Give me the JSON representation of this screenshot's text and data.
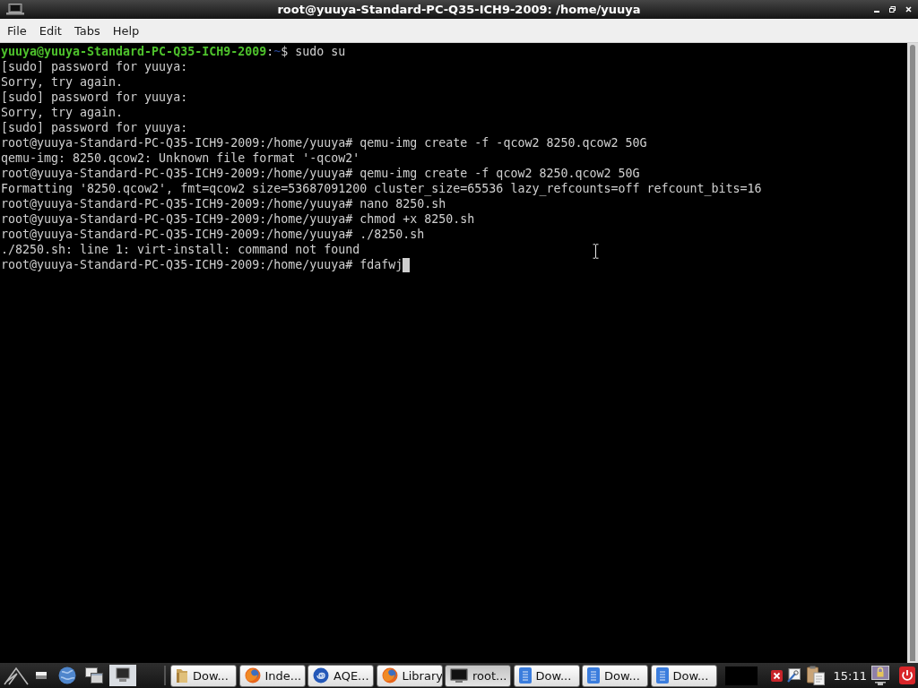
{
  "window": {
    "title": "root@yuuya-Standard-PC-Q35-ICH9-2009: /home/yuuya"
  },
  "menu": [
    "File",
    "Edit",
    "Tabs",
    "Help"
  ],
  "terminal": {
    "lines": [
      {
        "kind": "colored",
        "segments": [
          {
            "kind": "user_host",
            "text": "yuuya@yuuya-Standard-PC-Q35-ICH9-2009"
          },
          {
            "kind": "plain",
            "text": ":"
          },
          {
            "kind": "path",
            "text": "~"
          },
          {
            "kind": "plain",
            "text": "$ sudo su"
          }
        ]
      },
      {
        "kind": "plain",
        "text": "[sudo] password for yuuya:"
      },
      {
        "kind": "plain",
        "text": "Sorry, try again."
      },
      {
        "kind": "plain",
        "text": "[sudo] password for yuuya:"
      },
      {
        "kind": "plain",
        "text": "Sorry, try again."
      },
      {
        "kind": "plain",
        "text": "[sudo] password for yuuya:"
      },
      {
        "kind": "plain",
        "text": "root@yuuya-Standard-PC-Q35-ICH9-2009:/home/yuuya# qemu-img create -f -qcow2 8250.qcow2 50G"
      },
      {
        "kind": "plain",
        "text": "qemu-img: 8250.qcow2: Unknown file format '-qcow2'"
      },
      {
        "kind": "plain",
        "text": "root@yuuya-Standard-PC-Q35-ICH9-2009:/home/yuuya# qemu-img create -f qcow2 8250.qcow2 50G"
      },
      {
        "kind": "plain",
        "text": "Formatting '8250.qcow2', fmt=qcow2 size=53687091200 cluster_size=65536 lazy_refcounts=off refcount_bits=16"
      },
      {
        "kind": "plain",
        "text": "root@yuuya-Standard-PC-Q35-ICH9-2009:/home/yuuya# nano 8250.sh"
      },
      {
        "kind": "plain",
        "text": "root@yuuya-Standard-PC-Q35-ICH9-2009:/home/yuuya# chmod +x 8250.sh"
      },
      {
        "kind": "plain",
        "text": "root@yuuya-Standard-PC-Q35-ICH9-2009:/home/yuuya# ./8250.sh"
      },
      {
        "kind": "plain",
        "text": "./8250.sh: line 1: virt-install: command not found"
      },
      {
        "kind": "plain",
        "text": "root@yuuya-Standard-PC-Q35-ICH9-2009:/home/yuuya# fdafwj"
      }
    ],
    "cursor_shown": true
  },
  "taskbar": {
    "tasks": [
      {
        "label": "Dow...",
        "kind": "folder",
        "selected": false
      },
      {
        "label": "Inde...",
        "kind": "browser",
        "selected": false
      },
      {
        "label": "AQE...",
        "kind": "round_logo",
        "selected": false
      },
      {
        "label": "Library",
        "kind": "browser",
        "selected": false
      },
      {
        "label": "root...",
        "kind": "terminal",
        "selected": true
      },
      {
        "label": "Dow...",
        "kind": "document",
        "selected": false
      },
      {
        "label": "Dow...",
        "kind": "document",
        "selected": false
      },
      {
        "label": "Dow...",
        "kind": "document",
        "selected": false
      }
    ],
    "clock": "15:11"
  }
}
